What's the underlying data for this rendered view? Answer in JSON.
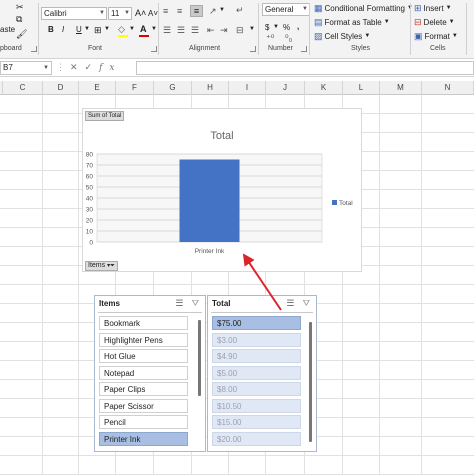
{
  "ribbon": {
    "clipboard": {
      "label": "pboard",
      "paste_label": "aste"
    },
    "font": {
      "label": "Font",
      "font_name": "Calibri",
      "font_size": "11",
      "grow": "A˄",
      "shrink": "A˅",
      "bold": "B",
      "italic": "I",
      "underline": "U"
    },
    "alignment": {
      "label": "Alignment"
    },
    "number": {
      "label": "Number",
      "format": "General",
      "currency": "$",
      "percent": "%",
      "comma": ","
    },
    "styles": {
      "label": "Styles",
      "conditional": "Conditional Formatting",
      "format_table": "Format as Table",
      "cell_styles": "Cell Styles"
    },
    "cells": {
      "label": "Cells",
      "insert": "Insert",
      "delete": "Delete",
      "format": "Format"
    }
  },
  "formula_bar": {
    "name_box": "B7",
    "fx": "fx",
    "value": ""
  },
  "columns": [
    "C",
    "D",
    "E",
    "F",
    "G",
    "H",
    "I",
    "J",
    "K",
    "L",
    "M",
    "N"
  ],
  "pivot_chart": {
    "field_button": "Sum of Total",
    "axis_field_button": "Items"
  },
  "chart_data": {
    "type": "bar",
    "title": "Total",
    "categories": [
      "Printer Ink"
    ],
    "series": [
      {
        "name": "Total",
        "values": [
          75
        ]
      }
    ],
    "ylim": [
      0,
      80
    ],
    "yticks": [
      0,
      10,
      20,
      30,
      40,
      50,
      60,
      70,
      80
    ],
    "legend": "right",
    "grid": true,
    "bar_color": "#4472c4"
  },
  "slicers": {
    "items": {
      "title": "Items",
      "entries": [
        {
          "label": "Bookmark",
          "state": "off"
        },
        {
          "label": "Highlighter Pens",
          "state": "off"
        },
        {
          "label": "Hot Glue",
          "state": "off"
        },
        {
          "label": "Notepad",
          "state": "off"
        },
        {
          "label": "Paper Clips",
          "state": "off"
        },
        {
          "label": "Paper Scissor",
          "state": "off"
        },
        {
          "label": "Pencil",
          "state": "off"
        },
        {
          "label": "Printer Ink",
          "state": "on"
        }
      ]
    },
    "total": {
      "title": "Total",
      "entries": [
        {
          "label": "$75.00",
          "state": "first"
        },
        {
          "label": "$3.00",
          "state": "dis"
        },
        {
          "label": "$4.90",
          "state": "dis"
        },
        {
          "label": "$5.00",
          "state": "dis"
        },
        {
          "label": "$8.00",
          "state": "dis"
        },
        {
          "label": "$10.50",
          "state": "dis"
        },
        {
          "label": "$15.00",
          "state": "dis"
        },
        {
          "label": "$20.00",
          "state": "dis"
        }
      ]
    }
  },
  "colors": {
    "selected_item": "#a8bfe3",
    "arrow": "#d9262c",
    "bar": "#4472c4"
  }
}
